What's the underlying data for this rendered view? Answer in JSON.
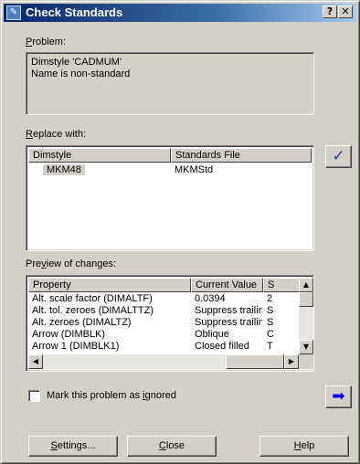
{
  "window": {
    "title": "Check Standards",
    "help_glyph": "?",
    "close_glyph": "✕",
    "icon_glyph": "✎"
  },
  "problem": {
    "label_accel": "P",
    "label_rest": "roblem:",
    "lines": [
      "Dimstyle 'CADMUM'",
      "Name is non-standard"
    ]
  },
  "replace": {
    "label_accel": "R",
    "label_rest": "eplace with:",
    "columns": [
      "Dimstyle",
      "Standards File"
    ],
    "rows": [
      {
        "dimstyle": "MKM48",
        "file": "MKMStd"
      }
    ],
    "fix_icon": "checkmark-icon",
    "fix_glyph": "✓"
  },
  "preview": {
    "label_pre": "Pre",
    "label_accel": "v",
    "label_rest": "iew of changes:",
    "columns": [
      "Property",
      "Current Value",
      "S"
    ],
    "rows": [
      {
        "property": "Alt. scale factor (DIMALTF)",
        "current": "0.0394",
        "standard": "2"
      },
      {
        "property": "Alt. tol. zeroes (DIMALTTZ)",
        "current": "Suppress trailing...",
        "standard": "S"
      },
      {
        "property": "Alt. zeroes (DIMALTZ)",
        "current": "Suppress trailing...",
        "standard": "S"
      },
      {
        "property": "Arrow (DIMBLK)",
        "current": "Oblique",
        "standard": "C"
      },
      {
        "property": "Arrow 1 (DIMBLK1)",
        "current": "Closed filled",
        "standard": "T"
      }
    ],
    "scroll_up_glyph": "▲",
    "scroll_down_glyph": "▼",
    "scroll_left_glyph": "◀",
    "scroll_right_glyph": "▶"
  },
  "ignore": {
    "label_pre": "Mark this problem as ",
    "label_accel": "i",
    "label_rest": "gnored",
    "checked": false
  },
  "next": {
    "icon": "arrow-right-icon",
    "glyph": "➡",
    "color": "#0000ff"
  },
  "buttons": {
    "settings_accel": "S",
    "settings_rest": "ettings...",
    "close_accel": "C",
    "close_rest": "lose",
    "help_accel": "H",
    "help_rest": "elp"
  },
  "colors": {
    "face": "#d4d0c8",
    "title_start": "#0a246a",
    "check": "#1a3fa0"
  }
}
